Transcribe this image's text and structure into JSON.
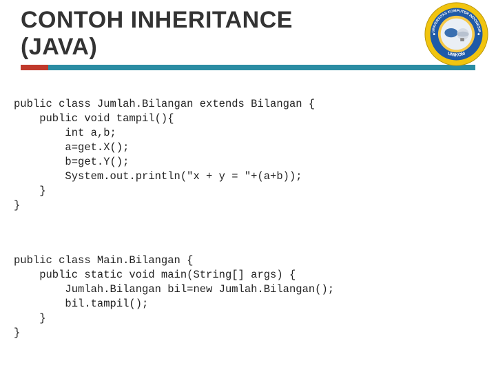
{
  "header": {
    "title_line1": "CONTOH INHERITANCE",
    "title_line2": "(JAVA)"
  },
  "logo": {
    "outer_text": "UNIVERSITAS KOMPUTER INDONESIA",
    "inner_text": "UNIKOM",
    "colors": {
      "ring_outer": "#f1c40f",
      "ring_inner": "#1e5aa8",
      "center": "#f39c12"
    }
  },
  "code": {
    "block1": "public class Jumlah.Bilangan extends Bilangan {\n    public void tampil(){\n        int a,b;\n        a=get.X();\n        b=get.Y();\n        System.out.println(\"x + y = \"+(a+b));\n    }\n}",
    "block2": "public class Main.Bilangan {\n    public static void main(String[] args) {\n        Jumlah.Bilangan bil=new Jumlah.Bilangan();\n        bil.tampil();\n    }\n}"
  }
}
